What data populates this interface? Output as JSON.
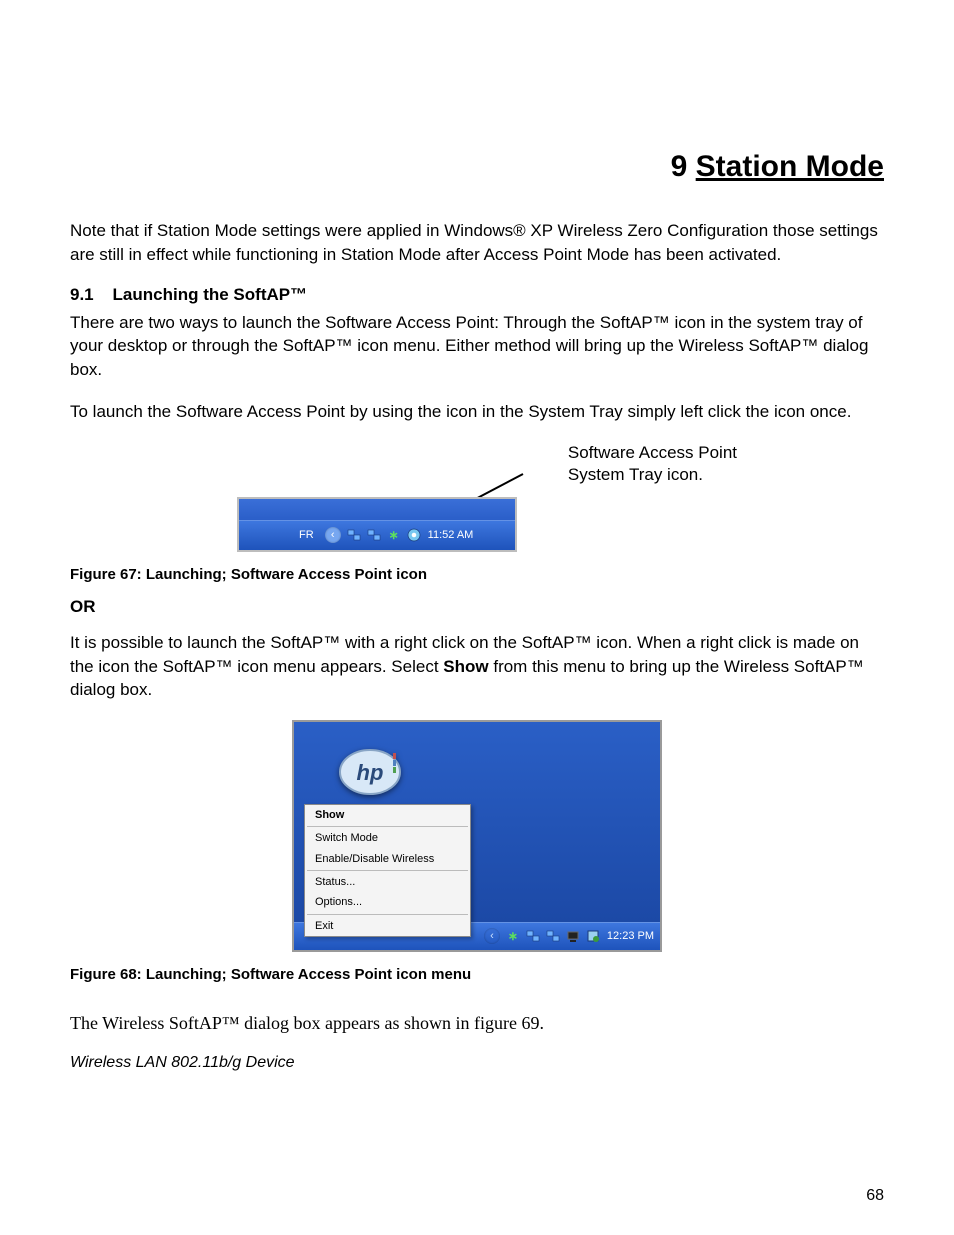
{
  "chapter": {
    "number": "9",
    "title": "Station Mode"
  },
  "intro_note": "Note that if Station Mode settings were applied in Windows® XP Wireless Zero Configuration those settings are still in effect while functioning in Station Mode after Access Point Mode has been activated.",
  "section": {
    "number": "9.1",
    "title": "Launching the SoftAP™"
  },
  "para1": "There are two ways to launch the Software Access Point:  Through the SoftAP™  icon in the system tray of your desktop or through the SoftAP™  icon menu. Either method will bring up the Wireless SoftAP™  dialog box.",
  "para2": "To launch the Software Access Point by using the icon in the System Tray simply left click the icon once.",
  "fig67": {
    "callout_line1": "Software Access Point",
    "callout_line2": "System Tray icon.",
    "tray": {
      "lang": "FR",
      "time": "11:52 AM"
    },
    "caption": "Figure 67: Launching; Software Access Point icon"
  },
  "or_label": "OR",
  "para3_pre": "It is possible to launch the SoftAP™  with a right click on the SoftAP™  icon.  When a right click is made on the icon the SoftAP™  icon menu appears.  Select ",
  "para3_bold": "Show",
  "para3_post": " from this menu to bring up the Wireless SoftAP™  dialog box.",
  "fig68": {
    "menu": {
      "show": "Show",
      "switch_mode": "Switch Mode",
      "enable_disable": "Enable/Disable Wireless",
      "status": "Status...",
      "options": "Options...",
      "exit": "Exit"
    },
    "taskbar_time": "12:23 PM",
    "caption": "Figure 68: Launching; Software Access Point icon menu"
  },
  "closing": "The Wireless SoftAP™  dialog box appears as shown in figure 69.",
  "footer": "Wireless LAN 802.11b/g Device",
  "page_number": "68"
}
